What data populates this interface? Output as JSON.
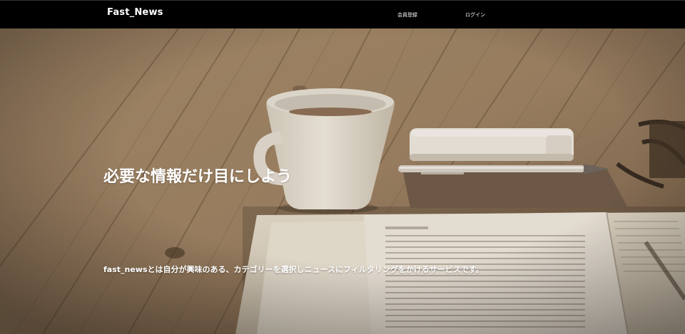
{
  "header": {
    "brand": "Fast_News",
    "nav": {
      "register": "会員登録",
      "login": "ログイン"
    }
  },
  "hero": {
    "headline": "必要な情報だけ目にしよう",
    "description": "fast_newsとは自分が興味のある、カテゴリーを選択しニュースにフィルタリングをかけるサービスです。",
    "background_image": "coffee-cup-phone-pen-newspaper-on-wooden-table"
  },
  "colors": {
    "header_bg": "#000000",
    "text": "#ffffff",
    "wood_tone": "#9a8163"
  }
}
